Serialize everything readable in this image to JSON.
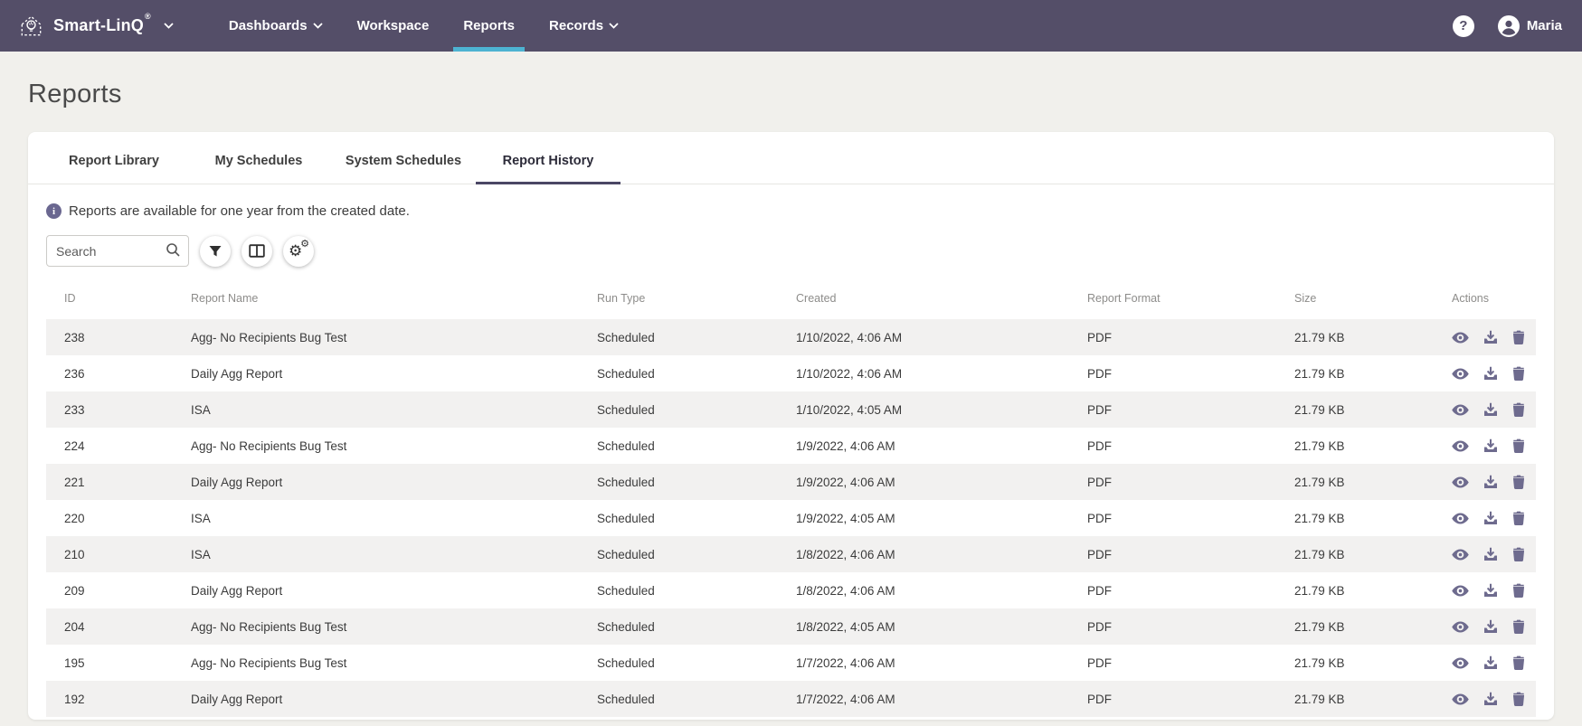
{
  "navbar": {
    "brand": "Smart-LinQ",
    "brand_registered": "®",
    "items": [
      {
        "label": "Dashboards"
      },
      {
        "label": "Workspace"
      },
      {
        "label": "Reports"
      },
      {
        "label": "Records"
      }
    ],
    "help_glyph": "?",
    "user_name": "Maria"
  },
  "page": {
    "title": "Reports"
  },
  "tabs": [
    {
      "label": "Report Library",
      "active": false
    },
    {
      "label": "My Schedules",
      "active": false
    },
    {
      "label": "System Schedules",
      "active": false
    },
    {
      "label": "Report History",
      "active": true
    }
  ],
  "info": {
    "glyph": "i",
    "message": "Reports are available for one year from the created date."
  },
  "toolbar": {
    "search_placeholder": "Search"
  },
  "table": {
    "columns": [
      "ID",
      "Report Name",
      "Run Type",
      "Created",
      "Report Format",
      "Size",
      "Actions"
    ],
    "rows": [
      {
        "id": "238",
        "name": "Agg- No Recipients Bug Test",
        "run_type": "Scheduled",
        "created": "1/10/2022, 4:06 AM",
        "format": "PDF",
        "size": "21.79 KB"
      },
      {
        "id": "236",
        "name": "Daily Agg Report",
        "run_type": "Scheduled",
        "created": "1/10/2022, 4:06 AM",
        "format": "PDF",
        "size": "21.79 KB"
      },
      {
        "id": "233",
        "name": "ISA",
        "run_type": "Scheduled",
        "created": "1/10/2022, 4:05 AM",
        "format": "PDF",
        "size": "21.79 KB"
      },
      {
        "id": "224",
        "name": "Agg- No Recipients Bug Test",
        "run_type": "Scheduled",
        "created": "1/9/2022, 4:06 AM",
        "format": "PDF",
        "size": "21.79 KB"
      },
      {
        "id": "221",
        "name": "Daily Agg Report",
        "run_type": "Scheduled",
        "created": "1/9/2022, 4:06 AM",
        "format": "PDF",
        "size": "21.79 KB"
      },
      {
        "id": "220",
        "name": "ISA",
        "run_type": "Scheduled",
        "created": "1/9/2022, 4:05 AM",
        "format": "PDF",
        "size": "21.79 KB"
      },
      {
        "id": "210",
        "name": "ISA",
        "run_type": "Scheduled",
        "created": "1/8/2022, 4:06 AM",
        "format": "PDF",
        "size": "21.79 KB"
      },
      {
        "id": "209",
        "name": "Daily Agg Report",
        "run_type": "Scheduled",
        "created": "1/8/2022, 4:06 AM",
        "format": "PDF",
        "size": "21.79 KB"
      },
      {
        "id": "204",
        "name": "Agg- No Recipients Bug Test",
        "run_type": "Scheduled",
        "created": "1/8/2022, 4:05 AM",
        "format": "PDF",
        "size": "21.79 KB"
      },
      {
        "id": "195",
        "name": "Agg- No Recipients Bug Test",
        "run_type": "Scheduled",
        "created": "1/7/2022, 4:06 AM",
        "format": "PDF",
        "size": "21.79 KB"
      },
      {
        "id": "192",
        "name": "Daily Agg Report",
        "run_type": "Scheduled",
        "created": "1/7/2022, 4:06 AM",
        "format": "PDF",
        "size": "21.79 KB"
      }
    ]
  },
  "colors": {
    "navbar_bg": "#544e68",
    "active_nav_underline": "#4db3d2",
    "active_tab_underline": "#4a4664",
    "page_bg": "#f1f0ec",
    "row_stripe": "#f2f1f0",
    "action_icon": "#6e6b8e",
    "info_icon_bg": "#6a6790"
  }
}
